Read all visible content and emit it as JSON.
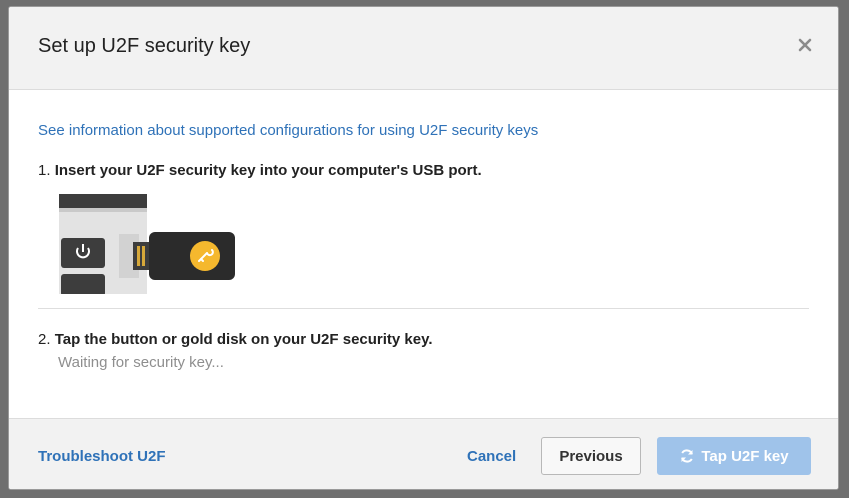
{
  "dialog": {
    "title": "Set up U2F security key",
    "close_icon": "close-icon"
  },
  "body": {
    "info_link": "See information about supported configurations for using U2F security keys",
    "step1": {
      "number": "1.",
      "text": "Insert your U2F security key into your computer's USB port."
    },
    "illustration_icon": "usb-key-illustration",
    "step2": {
      "number": "2.",
      "text": "Tap the button or gold disk on your U2F security key.",
      "status": "Waiting for security key..."
    }
  },
  "footer": {
    "troubleshoot_label": "Troubleshoot U2F",
    "cancel_label": "Cancel",
    "previous_label": "Previous",
    "primary_label": "Tap U2F key",
    "primary_icon": "refresh-icon"
  },
  "colors": {
    "link": "#2f72b8",
    "primary_button_disabled": "#9fc3ea",
    "header_bg": "#f2f2f2",
    "key_gold": "#f5b82e"
  }
}
